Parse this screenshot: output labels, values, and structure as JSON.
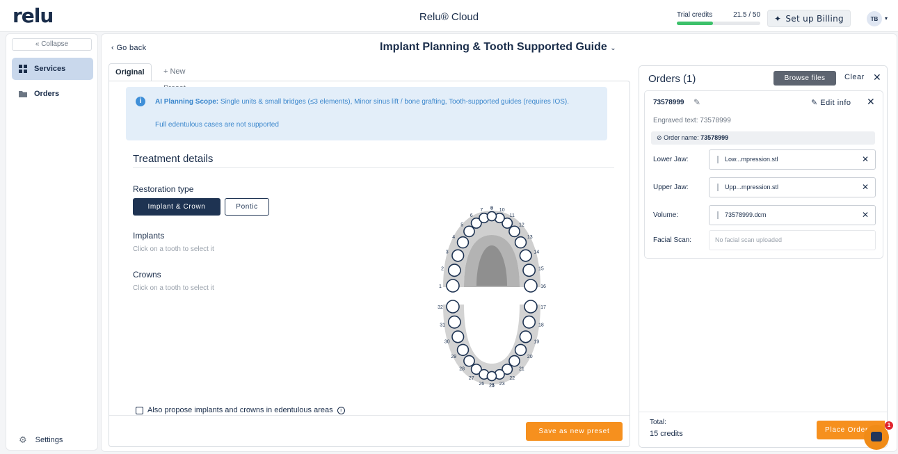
{
  "app": {
    "logo": "relu",
    "title": "Relu® Cloud"
  },
  "topbar": {
    "credits_label": "Trial credits",
    "credits_value": "21.5 / 50",
    "credits_fraction": 0.43,
    "billing_label": "Set up Billing",
    "avatar_initials": "TB"
  },
  "sidebar": {
    "collapse_label": "« Collapse",
    "items": [
      {
        "label": "Services",
        "icon": "grid-icon",
        "active": true
      },
      {
        "label": "Orders",
        "icon": "folder-icon",
        "active": false
      }
    ],
    "settings_label": "Settings"
  },
  "page": {
    "go_back": "‹ Go back",
    "title": "Implant Planning & Tooth Supported Guide",
    "tabs": [
      "Original",
      "+ New Preset"
    ]
  },
  "info": {
    "scope_label": "AI Planning Scope:",
    "scope_text": " Single units & small bridges (≤3 elements), Minor sinus lift / bone grafting, Tooth-supported guides (requires IOS).",
    "note": "Full edentulous cases are not supported"
  },
  "treatment": {
    "title": "Treatment details",
    "restoration_label": "Restoration type",
    "options": [
      "Implant & Crown",
      "Pontic"
    ],
    "implants_label": "Implants",
    "implants_hint": "Click on a tooth to select it",
    "crowns_label": "Crowns",
    "crowns_hint": "Click on a tooth to select it",
    "checkbox_label": "Also propose implants and crowns in edentulous areas",
    "save_preset": "Save as new preset"
  },
  "teeth_numbers": {
    "upper_left": [
      "1",
      "2",
      "3",
      "4",
      "5",
      "6",
      "7",
      "8"
    ],
    "upper_right": [
      "9",
      "10",
      "11",
      "12",
      "13",
      "14",
      "15",
      "16"
    ],
    "lower_left": [
      "32",
      "31",
      "30",
      "29",
      "28",
      "27",
      "26",
      "25"
    ],
    "lower_right": [
      "24",
      "23",
      "22",
      "21",
      "20",
      "19",
      "18",
      "17"
    ]
  },
  "orders": {
    "title": "Orders (1)",
    "browse": "Browse files",
    "clear": "Clear",
    "order_id": "73578999",
    "edit_info": "Edit info",
    "engraved_label": "Engraved text:",
    "engraved_value": "73578999",
    "order_name_label": "Order name:",
    "order_name_value": "73578999",
    "lower_jaw_label": "Lower Jaw:",
    "lower_jaw_file": "Low...mpression.stl",
    "upper_jaw_label": "Upper Jaw:",
    "upper_jaw_file": "Upp...mpression.stl",
    "volume_label": "Volume:",
    "volume_file": "73578999.dcm",
    "facial_label": "Facial Scan:",
    "facial_placeholder": "No facial scan uploaded",
    "total_label": "Total:",
    "total_value": "15 credits",
    "place_order": "Place Order"
  },
  "chat": {
    "badge": "1"
  },
  "colors": {
    "navy": "#1e3352",
    "orange": "#f6901e",
    "info_blue": "#3a86cc",
    "credits_green": "#3cc16a",
    "active_nav": "#c9d8ec"
  }
}
